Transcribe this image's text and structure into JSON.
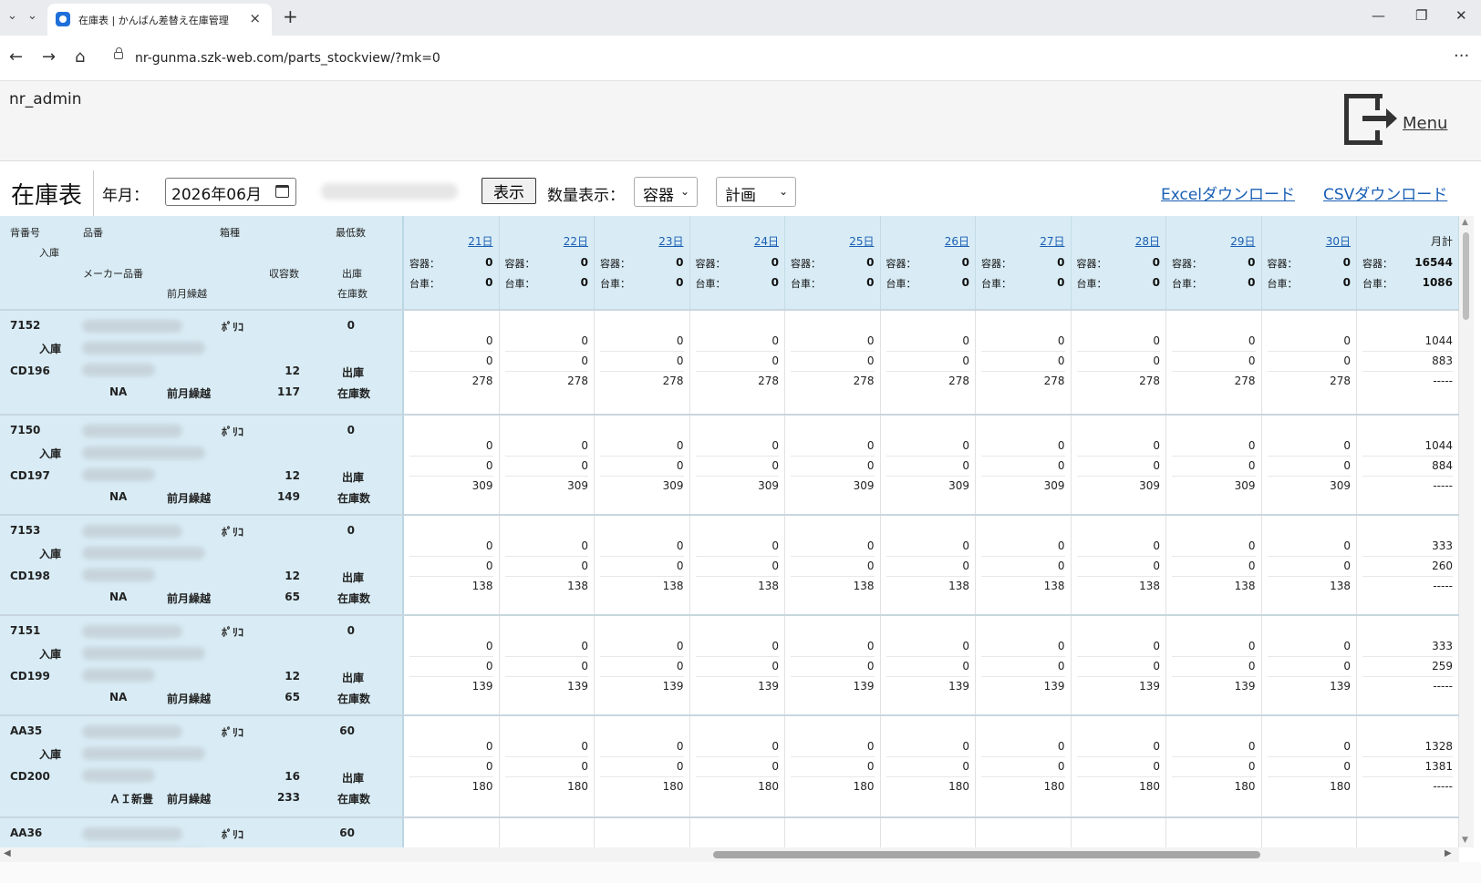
{
  "browser": {
    "tab_title": "在庫表 | かんばん差替え在庫管理",
    "url": "nr-gunma.szk-web.com/parts_stockview/?mk=0"
  },
  "header": {
    "user": "nr_admin",
    "menu_label": "Menu"
  },
  "toolbar": {
    "title": "在庫表",
    "year_month_label": "年月：",
    "year_month_value": "2026年06月",
    "show_button": "表示",
    "quantity_label": "数量表示：",
    "quantity_select": "容器",
    "plan_select": "計画",
    "excel_link": "Excelダウンロード",
    "csv_link": "CSVダウンロード"
  },
  "left_header": {
    "back_number": "背番号",
    "part_number": "品番",
    "box_type": "箱種",
    "min_count": "最低数",
    "receipt": "入庫",
    "maker_part": "メーカー品番",
    "capacity": "収容数",
    "shipment": "出庫",
    "carryover": "前月繰越",
    "stock": "在庫数"
  },
  "day_columns": [
    {
      "day": "21日",
      "c_label": "容器：",
      "c_val": "0",
      "d_label": "台車：",
      "d_val": "0"
    },
    {
      "day": "22日",
      "c_label": "容器：",
      "c_val": "0",
      "d_label": "台車：",
      "d_val": "0"
    },
    {
      "day": "23日",
      "c_label": "容器：",
      "c_val": "0",
      "d_label": "台車：",
      "d_val": "0"
    },
    {
      "day": "24日",
      "c_label": "容器：",
      "c_val": "0",
      "d_label": "台車：",
      "d_val": "0"
    },
    {
      "day": "25日",
      "c_label": "容器：",
      "c_val": "0",
      "d_label": "台車：",
      "d_val": "0"
    },
    {
      "day": "26日",
      "c_label": "容器：",
      "c_val": "0",
      "d_label": "台車：",
      "d_val": "0"
    },
    {
      "day": "27日",
      "c_label": "容器：",
      "c_val": "0",
      "d_label": "台車：",
      "d_val": "0"
    },
    {
      "day": "28日",
      "c_label": "容器：",
      "c_val": "0",
      "d_label": "台車：",
      "d_val": "0"
    },
    {
      "day": "29日",
      "c_label": "容器：",
      "c_val": "0",
      "d_label": "台車：",
      "d_val": "0"
    },
    {
      "day": "30日",
      "c_label": "容器：",
      "c_val": "0",
      "d_label": "台車：",
      "d_val": "0"
    },
    {
      "day": "月計",
      "c_label": "容器：",
      "c_val": "16544",
      "d_label": "台車：",
      "d_val": "1086"
    }
  ],
  "rows": [
    {
      "back": "7152",
      "box": "ﾎﾟﾘｺ",
      "min": "0",
      "receipt": "入庫",
      "code": "CD196",
      "cap": "12",
      "ship": "出庫",
      "maker": "NA",
      "carry_label": "前月繰越",
      "carry": "117",
      "stock": "在庫数",
      "days": [
        [
          "0",
          "0",
          "278"
        ],
        [
          "0",
          "0",
          "278"
        ],
        [
          "0",
          "0",
          "278"
        ],
        [
          "0",
          "0",
          "278"
        ],
        [
          "0",
          "0",
          "278"
        ],
        [
          "0",
          "0",
          "278"
        ],
        [
          "0",
          "0",
          "278"
        ],
        [
          "0",
          "0",
          "278"
        ],
        [
          "0",
          "0",
          "278"
        ],
        [
          "0",
          "0",
          "278"
        ],
        [
          "1044",
          "883",
          "-----"
        ]
      ]
    },
    {
      "back": "7150",
      "box": "ﾎﾟﾘｺ",
      "min": "0",
      "receipt": "入庫",
      "code": "CD197",
      "cap": "12",
      "ship": "出庫",
      "maker": "NA",
      "carry_label": "前月繰越",
      "carry": "149",
      "stock": "在庫数",
      "days": [
        [
          "0",
          "0",
          "309"
        ],
        [
          "0",
          "0",
          "309"
        ],
        [
          "0",
          "0",
          "309"
        ],
        [
          "0",
          "0",
          "309"
        ],
        [
          "0",
          "0",
          "309"
        ],
        [
          "0",
          "0",
          "309"
        ],
        [
          "0",
          "0",
          "309"
        ],
        [
          "0",
          "0",
          "309"
        ],
        [
          "0",
          "0",
          "309"
        ],
        [
          "0",
          "0",
          "309"
        ],
        [
          "1044",
          "884",
          "-----"
        ]
      ]
    },
    {
      "back": "7153",
      "box": "ﾎﾟﾘｺ",
      "min": "0",
      "receipt": "入庫",
      "code": "CD198",
      "cap": "12",
      "ship": "出庫",
      "maker": "NA",
      "carry_label": "前月繰越",
      "carry": "65",
      "stock": "在庫数",
      "days": [
        [
          "0",
          "0",
          "138"
        ],
        [
          "0",
          "0",
          "138"
        ],
        [
          "0",
          "0",
          "138"
        ],
        [
          "0",
          "0",
          "138"
        ],
        [
          "0",
          "0",
          "138"
        ],
        [
          "0",
          "0",
          "138"
        ],
        [
          "0",
          "0",
          "138"
        ],
        [
          "0",
          "0",
          "138"
        ],
        [
          "0",
          "0",
          "138"
        ],
        [
          "0",
          "0",
          "138"
        ],
        [
          "333",
          "260",
          "-----"
        ]
      ]
    },
    {
      "back": "7151",
      "box": "ﾎﾟﾘｺ",
      "min": "0",
      "receipt": "入庫",
      "code": "CD199",
      "cap": "12",
      "ship": "出庫",
      "maker": "NA",
      "carry_label": "前月繰越",
      "carry": "65",
      "stock": "在庫数",
      "days": [
        [
          "0",
          "0",
          "139"
        ],
        [
          "0",
          "0",
          "139"
        ],
        [
          "0",
          "0",
          "139"
        ],
        [
          "0",
          "0",
          "139"
        ],
        [
          "0",
          "0",
          "139"
        ],
        [
          "0",
          "0",
          "139"
        ],
        [
          "0",
          "0",
          "139"
        ],
        [
          "0",
          "0",
          "139"
        ],
        [
          "0",
          "0",
          "139"
        ],
        [
          "0",
          "0",
          "139"
        ],
        [
          "333",
          "259",
          "-----"
        ]
      ]
    },
    {
      "back": "AA35",
      "box": "ﾎﾟﾘｺ",
      "min": "60",
      "receipt": "入庫",
      "code": "CD200",
      "cap": "16",
      "ship": "出庫",
      "maker": "ＡＩ新豊",
      "carry_label": "前月繰越",
      "carry": "233",
      "stock": "在庫数",
      "days": [
        [
          "0",
          "0",
          "180"
        ],
        [
          "0",
          "0",
          "180"
        ],
        [
          "0",
          "0",
          "180"
        ],
        [
          "0",
          "0",
          "180"
        ],
        [
          "0",
          "0",
          "180"
        ],
        [
          "0",
          "0",
          "180"
        ],
        [
          "0",
          "0",
          "180"
        ],
        [
          "0",
          "0",
          "180"
        ],
        [
          "0",
          "0",
          "180"
        ],
        [
          "0",
          "0",
          "180"
        ],
        [
          "1328",
          "1381",
          "-----"
        ]
      ]
    },
    {
      "back": "AA36",
      "box": "ﾎﾟﾘｺ",
      "min": "60",
      "receipt": "",
      "code": "",
      "cap": "",
      "ship": "",
      "maker": "",
      "carry_label": "",
      "carry": "",
      "stock": "",
      "days": [
        [
          "",
          "",
          ""
        ],
        [
          "",
          "",
          ""
        ],
        [
          "",
          "",
          ""
        ],
        [
          "",
          "",
          ""
        ],
        [
          "",
          "",
          ""
        ],
        [
          "",
          "",
          ""
        ],
        [
          "",
          "",
          ""
        ],
        [
          "",
          "",
          ""
        ],
        [
          "",
          "",
          ""
        ],
        [
          "",
          "",
          ""
        ],
        [
          "",
          "",
          ""
        ]
      ]
    }
  ]
}
